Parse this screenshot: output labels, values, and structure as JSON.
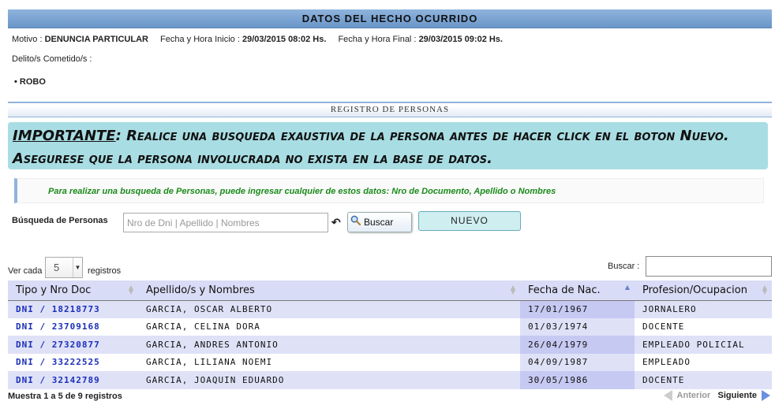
{
  "hecho": {
    "title": "DATOS DEL HECHO OCURRIDO",
    "motivo_label": "Motivo :",
    "motivo_value": "DENUNCIA PARTICULAR",
    "inicio_label": "Fecha y Hora Inicio :",
    "inicio_value": "29/03/2015 08:02 Hs.",
    "final_label": "Fecha y Hora Final :",
    "final_value": "29/03/2015 09:02 Hs.",
    "delito_label": "Delito/s Cometido/s :",
    "delito_item": "ROBO"
  },
  "registro": {
    "title": "REGISTRO DE PERSONAS",
    "important_title": "IMPORTANTE",
    "important_text": ": Realice una busqueda exaustiva de la persona antes de hacer click en el boton Nuevo. Asegurese que la persona involucrada no exista en la base de datos.",
    "hint": "Para realizar una busqueda de Personas, puede ingresar cualquier de estos datos: Nro de Documento, Apellido o Nombres",
    "search_label": "Búsqueda de Personas",
    "search_placeholder": "Nro de Dni | Apellido | Nombres",
    "buscar_button": "Buscar",
    "nuevo_button": "NUEVO"
  },
  "table": {
    "ver_cada": "Ver cada",
    "page_size": "5",
    "registros": "registros",
    "buscar_label": "Buscar :",
    "columns": [
      "Tipo y Nro Doc",
      "Apellido/s y Nombres",
      "Fecha de Nac.",
      "Profesion/Ocupacion"
    ],
    "rows": [
      {
        "doc": "DNI / 18218773",
        "name": "GARCIA, OSCAR ALBERTO",
        "fecha": "17/01/1967",
        "prof": "JORNALERO"
      },
      {
        "doc": "DNI / 23709168",
        "name": "GARCIA, CELINA DORA",
        "fecha": "01/03/1974",
        "prof": "DOCENTE"
      },
      {
        "doc": "DNI / 27320877",
        "name": "GARCIA, ANDRES ANTONIO",
        "fecha": "26/04/1979",
        "prof": "EMPLEADO POLICIAL"
      },
      {
        "doc": "DNI / 33222525",
        "name": "GARCIA, LILIANA NOEMI",
        "fecha": "04/09/1987",
        "prof": "EMPLEADO"
      },
      {
        "doc": "DNI / 32142789",
        "name": "GARCIA, JOAQUIN EDUARDO",
        "fecha": "30/05/1986",
        "prof": "DOCENTE"
      }
    ],
    "info": "Muestra 1 a 5 de 9 registros",
    "anterior": "Anterior",
    "siguiente": "Siguiente"
  },
  "icons": {
    "undo": "undo-icon",
    "search": "magnifier-icon",
    "prev": "triangle-left-icon",
    "next": "triangle-right-icon"
  },
  "colors": {
    "header_bar": "#8fb3dc",
    "important_bg": "#a8dde3",
    "hint_text": "#1a8a1a",
    "doc_link": "#1a2fb8",
    "row_stripe": "#dfe1f7"
  }
}
